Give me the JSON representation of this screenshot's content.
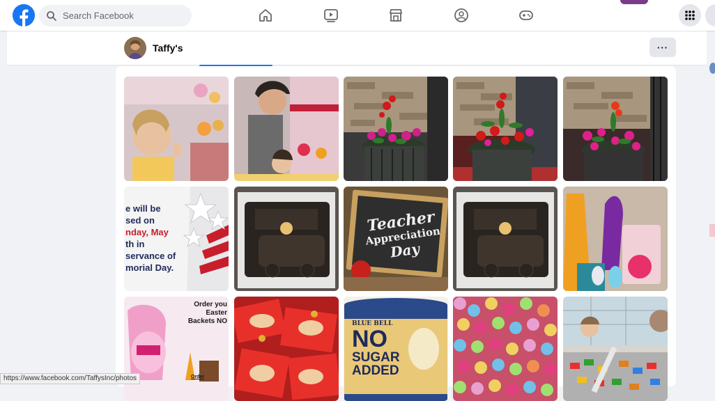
{
  "topbar": {
    "search_placeholder": "Search Facebook",
    "nav_icons": [
      "home-icon",
      "watch-icon",
      "marketplace-icon",
      "groups-icon",
      "gaming-icon"
    ],
    "brand_color": "#1877f2"
  },
  "profile": {
    "name": "Taffy's",
    "more_label": "···"
  },
  "photos": {
    "tiles": [
      {
        "id": 1,
        "overlay": []
      },
      {
        "id": 2,
        "overlay": []
      },
      {
        "id": 3,
        "overlay": []
      },
      {
        "id": 4,
        "overlay": []
      },
      {
        "id": 5,
        "overlay": []
      },
      {
        "id": 6,
        "overlay": [
          "e will be",
          "sed on",
          "nday, May",
          "th in",
          "servance of",
          "morial Day."
        ]
      },
      {
        "id": 7,
        "overlay": []
      },
      {
        "id": 8,
        "overlay": [
          "Teacher",
          "Appreciation",
          "Day"
        ]
      },
      {
        "id": 9,
        "overlay": []
      },
      {
        "id": 10,
        "overlay": []
      },
      {
        "id": 11,
        "overlay": [
          "Order you",
          "Easter",
          "Backets NO",
          "Order"
        ]
      },
      {
        "id": 12,
        "overlay": []
      },
      {
        "id": 13,
        "overlay": [
          "BLUE BELL",
          "NO",
          "SUGAR",
          "ADDED"
        ]
      },
      {
        "id": 14,
        "overlay": []
      },
      {
        "id": 15,
        "overlay": []
      }
    ]
  },
  "status_bar": {
    "url": "https://www.facebook.com/TaffysInc/photos"
  }
}
